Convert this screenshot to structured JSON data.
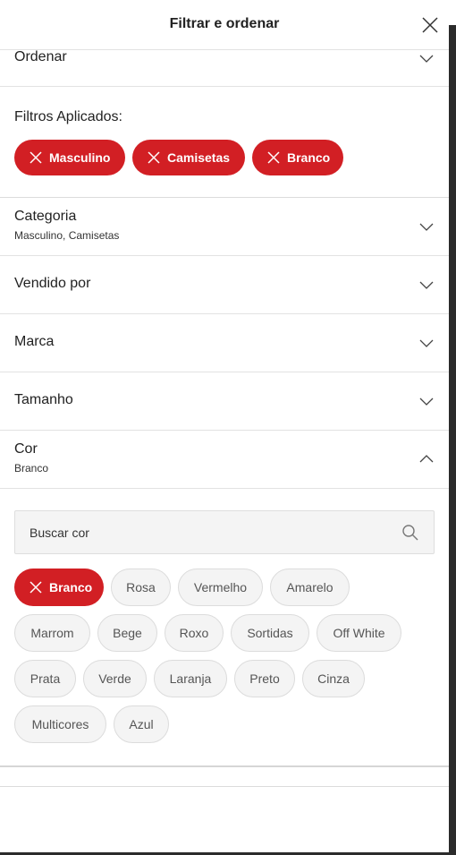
{
  "header": {
    "title": "Filtrar e ordenar"
  },
  "sort": {
    "label": "Ordenar"
  },
  "applied": {
    "label": "Filtros Aplicados:",
    "chips": [
      "Masculino",
      "Camisetas",
      "Branco"
    ]
  },
  "sections": [
    {
      "title": "Categoria",
      "subtitle": "Masculino, Camisetas"
    },
    {
      "title": "Vendido por"
    },
    {
      "title": "Marca"
    },
    {
      "title": "Tamanho"
    },
    {
      "title": "Cor",
      "subtitle": "Branco"
    }
  ],
  "color_filter": {
    "search_placeholder": "Buscar cor",
    "selected": "Branco",
    "options": [
      "Rosa",
      "Vermelho",
      "Amarelo",
      "Marrom",
      "Bege",
      "Roxo",
      "Sortidas",
      "Off White",
      "Prata",
      "Verde",
      "Laranja",
      "Preto",
      "Cinza",
      "Multicores",
      "Azul"
    ]
  },
  "colors": {
    "accent": "#d21f24",
    "chip_bg": "#f4f4f4"
  }
}
